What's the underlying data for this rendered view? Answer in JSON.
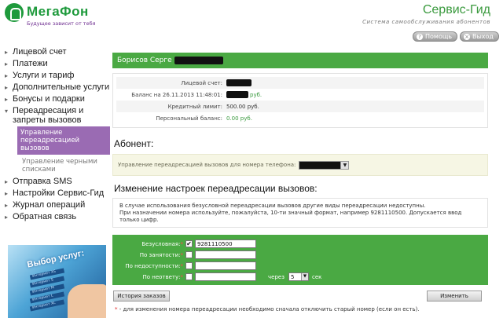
{
  "header": {
    "logo_name": "МегаФон",
    "logo_slogan": "Будущее зависит от тебя",
    "service_title": "Сервис-Гид",
    "service_subtitle": "Система самообслуживания абонентов",
    "help_label": "Помощь",
    "exit_label": "Выход",
    "help_icon": "?",
    "exit_icon": "×"
  },
  "sidebar": {
    "items": [
      {
        "label": "Лицевой счет"
      },
      {
        "label": "Платежи"
      },
      {
        "label": "Услуги и тариф"
      },
      {
        "label": "Дополнительные услуги"
      },
      {
        "label": "Бонусы и подарки"
      },
      {
        "label": "Переадресация и запреты вызовов"
      }
    ],
    "sub_items": [
      {
        "label": "Управление переадресацией вызовов"
      },
      {
        "label": "Управление черными списками"
      }
    ],
    "items_after": [
      {
        "label": "Отправка SMS"
      },
      {
        "label": "Настройки Сервис-Гид"
      },
      {
        "label": "Журнал операций"
      },
      {
        "label": "Обратная связь"
      }
    ],
    "promo": {
      "title": "Выбор услуг:",
      "lines": [
        "Интернет XS",
        "Интернет S",
        "Интернет M",
        "Интернет L",
        "Интернет XL"
      ]
    }
  },
  "account": {
    "name": "Борисов Серге",
    "rows": [
      {
        "label": "Лицевой счет:",
        "value": ""
      },
      {
        "label": "Баланс на 26.11.2013 11:48:01:",
        "value": "руб."
      },
      {
        "label": "Кредитный лимит:",
        "value": "500.00 руб."
      },
      {
        "label": "Персональный баланс:",
        "value": "0.00 руб."
      }
    ]
  },
  "abonent": {
    "heading": "Абонент:",
    "text": "Управление переадресацией вызовов для номера телефона:"
  },
  "forwarding": {
    "heading": "Изменение настроек переадресации вызовов:",
    "info_lines": [
      "В случае использования безусловной переадресации вызовов другие виды переадресации недоступны.",
      "При назначении номера используйте, пожалуйста, 10-ти значный формат, например 9281110500. Допускается ввод только цифр."
    ],
    "star": "*",
    "rows": [
      {
        "label": "Безусловная:",
        "checked": "✔",
        "value": "9281110500"
      },
      {
        "label": "По занятости:",
        "checked": "",
        "value": ""
      },
      {
        "label": "По недоступности:",
        "checked": "",
        "value": ""
      },
      {
        "label": "По неответу:",
        "checked": "",
        "value": ""
      }
    ],
    "via_label": "через",
    "delay_value": "5",
    "seconds_label": "сек",
    "history_button": "История заказов",
    "change_button": "Изменить",
    "footnote": " - для изменения номера переадресации необходимо сначала отключить старый номер (если он есть)."
  }
}
